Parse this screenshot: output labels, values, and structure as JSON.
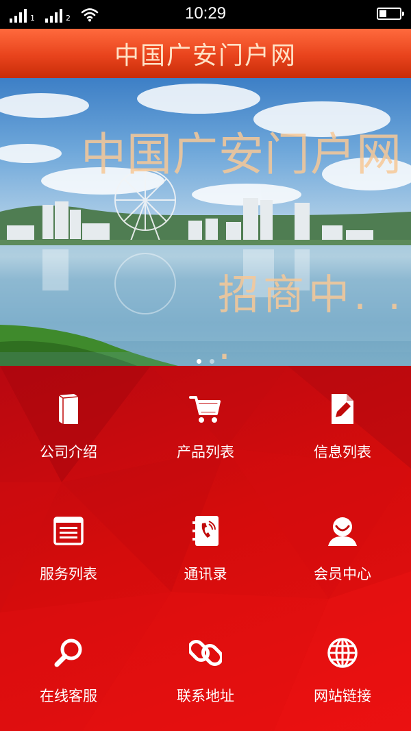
{
  "status_bar": {
    "time": "10:29",
    "sim1": "1",
    "sim2": "2",
    "battery_level": 0.35
  },
  "header": {
    "title": "中国广安门户网"
  },
  "banner": {
    "title": "中国广安门户网",
    "subtitle": "招商中. . .",
    "slide_count": 2,
    "active_slide": 1
  },
  "menu": {
    "items": [
      {
        "label": "公司介绍",
        "icon": "book-icon"
      },
      {
        "label": "产品列表",
        "icon": "cart-icon"
      },
      {
        "label": "信息列表",
        "icon": "edit-document-icon"
      },
      {
        "label": "服务列表",
        "icon": "list-icon"
      },
      {
        "label": "通讯录",
        "icon": "address-book-icon"
      },
      {
        "label": "会员中心",
        "icon": "user-icon"
      },
      {
        "label": "在线客服",
        "icon": "search-icon"
      },
      {
        "label": "联系地址",
        "icon": "link-icon"
      },
      {
        "label": "网站链接",
        "icon": "globe-icon"
      }
    ]
  },
  "colors": {
    "header_top": "#ff6a3d",
    "header_bottom": "#c82c08",
    "header_text": "#ffe2c6",
    "menu_bg": "#d40c0c",
    "banner_text": "#f7c896"
  }
}
